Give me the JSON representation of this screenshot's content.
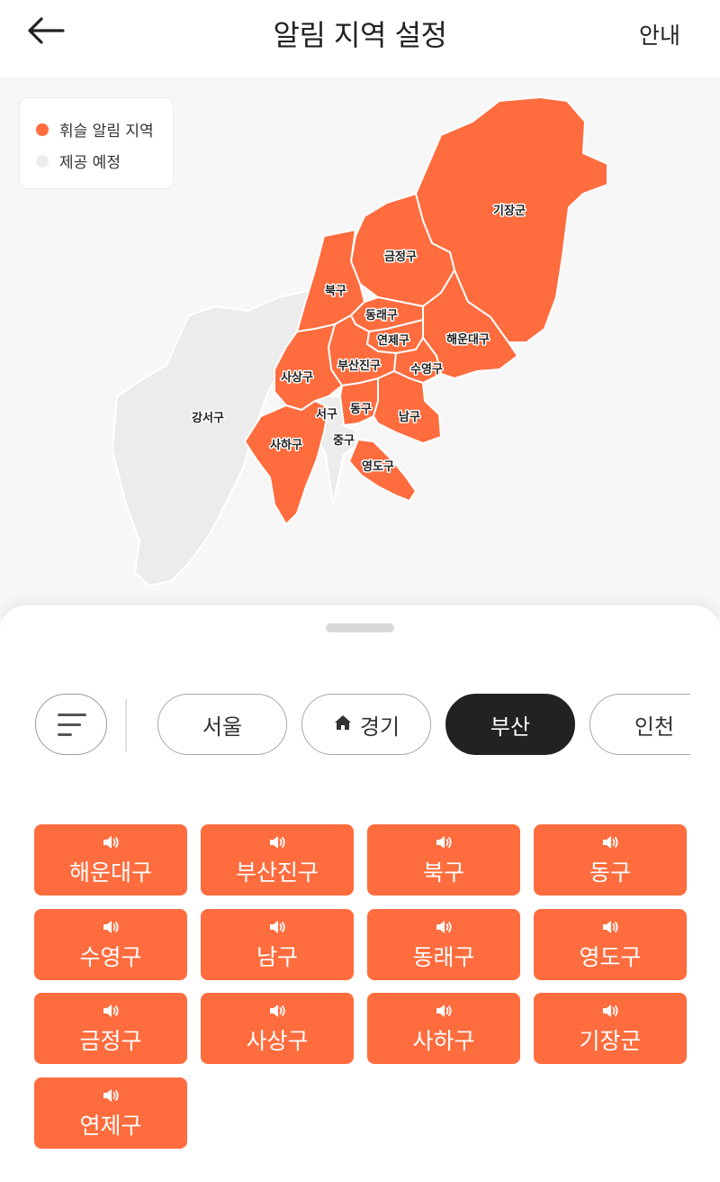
{
  "header": {
    "title": "알림 지역 설정",
    "guide_label": "안내"
  },
  "legend": {
    "items": [
      {
        "label": "휘슬 알림 지역",
        "color": "#ff6c3e"
      },
      {
        "label": "제공 예정",
        "color": "#ececec"
      }
    ]
  },
  "map": {
    "labels": {
      "gijang": "기장군",
      "geumjeong": "금정구",
      "buk": "북구",
      "dongnae": "동래구",
      "yeonje": "연제구",
      "haeundae": "해운대구",
      "sasang": "사상구",
      "busanjin": "부산진구",
      "suyeong": "수영구",
      "gangseo": "강서구",
      "seo": "서구",
      "dong": "동구",
      "nam": "남구",
      "saha": "사하구",
      "jung": "중구",
      "yeongdo": "영도구"
    }
  },
  "filters": {
    "chips": [
      {
        "label": "서울",
        "active": false
      },
      {
        "label": "경기",
        "active": false,
        "icon": "home-icon"
      },
      {
        "label": "부산",
        "active": true
      },
      {
        "label": "인천",
        "active": false
      }
    ]
  },
  "districts": [
    "해운대구",
    "부산진구",
    "북구",
    "동구",
    "수영구",
    "남구",
    "동래구",
    "영도구",
    "금정구",
    "사상구",
    "사하구",
    "기장군",
    "연제구"
  ],
  "tile_icon": "speaker-icon",
  "colors": {
    "accent": "#ff6c3e",
    "active_chip": "#222222",
    "unavailable": "#ececec"
  }
}
